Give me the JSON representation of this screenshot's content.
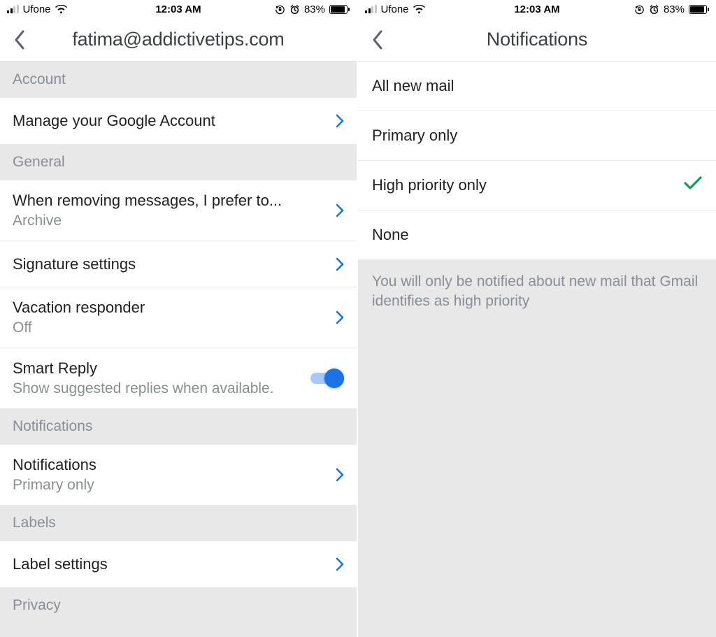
{
  "status": {
    "carrier": "Ufone",
    "time": "12:03 AM",
    "battery_pct": "83%",
    "battery_fill_pct": 83
  },
  "left": {
    "title": "fatima@addictivetips.com",
    "sections": {
      "account": {
        "header": "Account",
        "manage": "Manage your Google Account"
      },
      "general": {
        "header": "General",
        "remove_pref": {
          "title": "When removing messages, I prefer to...",
          "value": "Archive"
        },
        "signature": "Signature settings",
        "vacation": {
          "title": "Vacation responder",
          "value": "Off"
        },
        "smart_reply": {
          "title": "Smart Reply",
          "sub": "Show suggested replies when available.",
          "on": true
        }
      },
      "notifications": {
        "header": "Notifications",
        "row": {
          "title": "Notifications",
          "value": "Primary only"
        }
      },
      "labels": {
        "header": "Labels",
        "row": "Label settings"
      },
      "privacy": {
        "header": "Privacy"
      }
    }
  },
  "right": {
    "title": "Notifications",
    "options": {
      "all": "All new mail",
      "primary": "Primary only",
      "high": "High priority only",
      "none": "None",
      "selected": "high"
    },
    "footer": "You will only be notified about new mail that Gmail identifies as high priority"
  }
}
